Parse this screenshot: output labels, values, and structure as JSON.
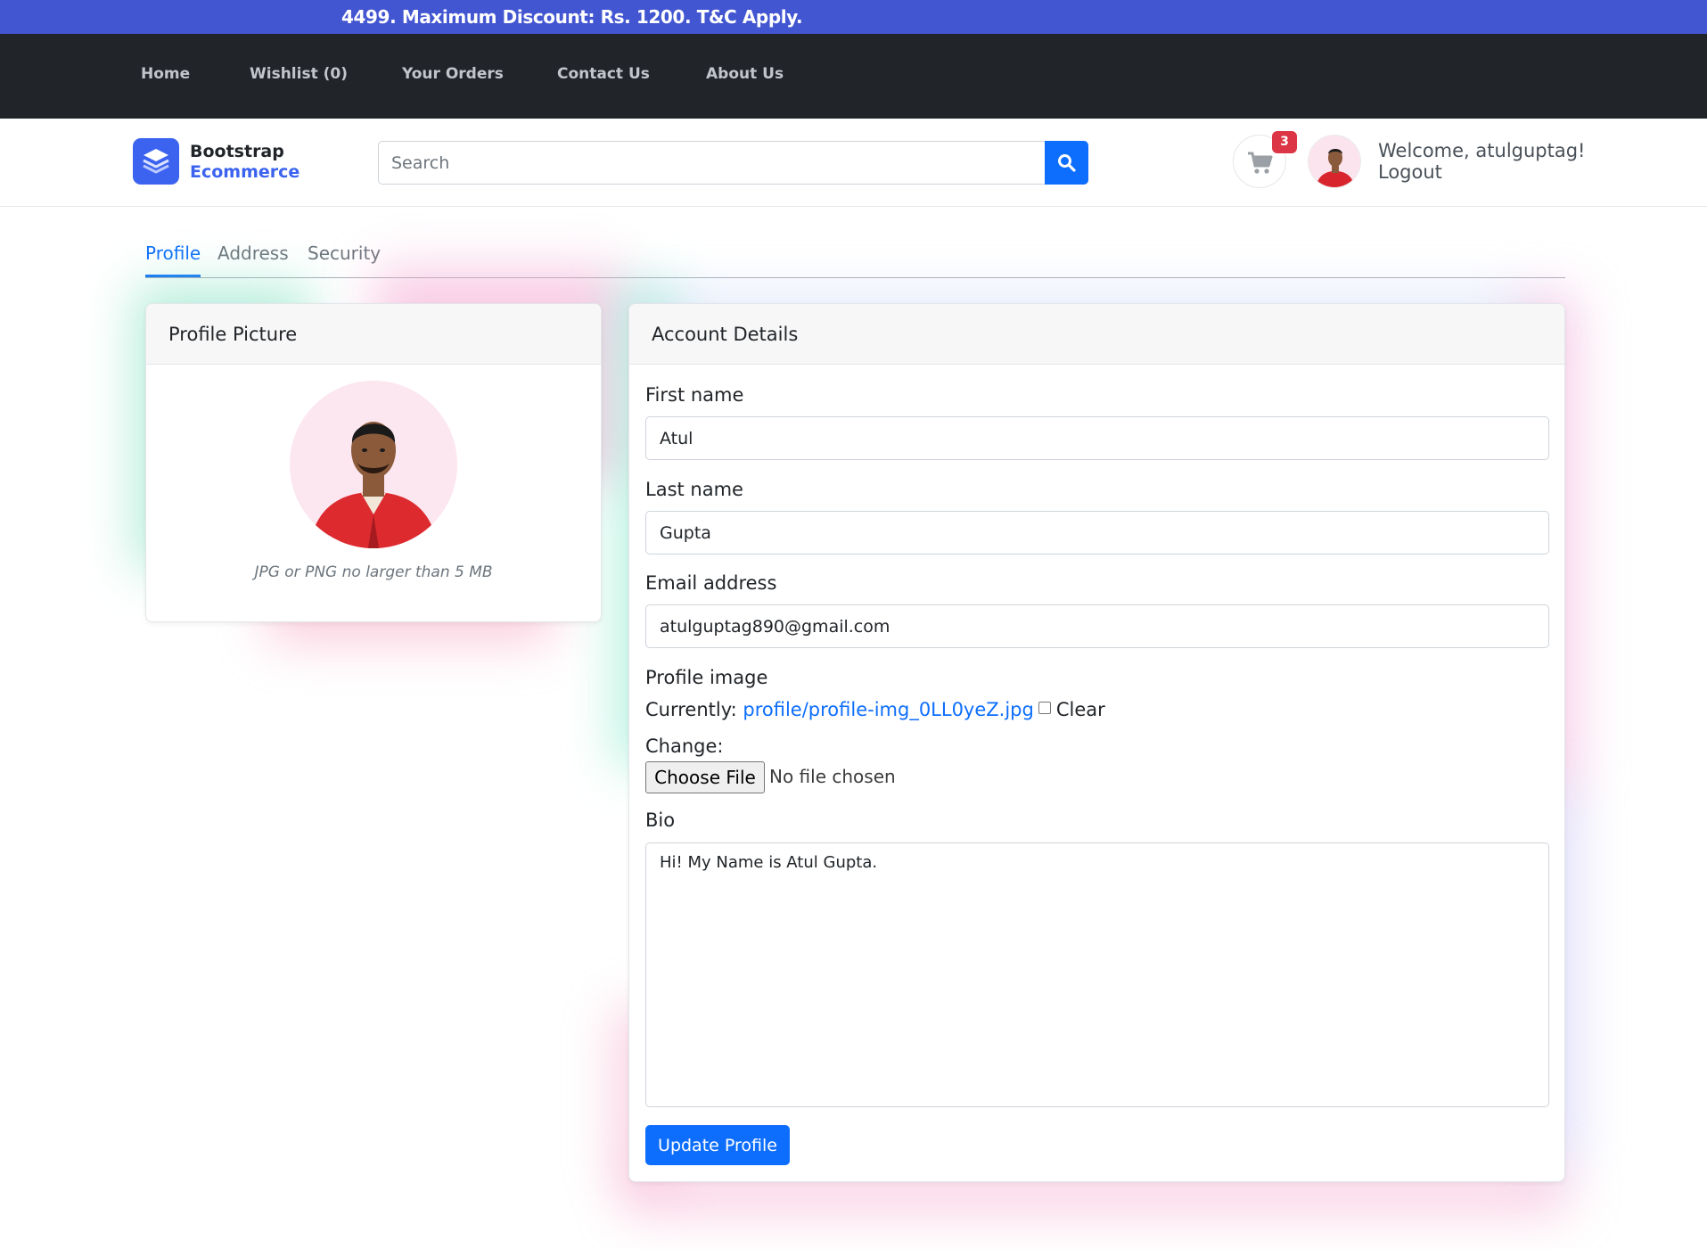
{
  "promo": {
    "text": "4499. Maximum Discount: Rs. 1200. T&C Apply."
  },
  "topnav": {
    "items": [
      {
        "label": "Home"
      },
      {
        "label": "Wishlist (0)"
      },
      {
        "label": "Your Orders"
      },
      {
        "label": "Contact Us"
      },
      {
        "label": "About Us"
      }
    ]
  },
  "header": {
    "brand_line1": "Bootstrap",
    "brand_line2": "Ecommerce",
    "search_placeholder": "Search",
    "cart_count": "3",
    "welcome": "Welcome, atulguptag!",
    "logout": "Logout"
  },
  "tabs": [
    {
      "label": "Profile",
      "active": true
    },
    {
      "label": "Address",
      "active": false
    },
    {
      "label": "Security",
      "active": false
    }
  ],
  "profile_card": {
    "title": "Profile Picture",
    "hint": "JPG or PNG no larger than 5 MB"
  },
  "account_card": {
    "title": "Account Details",
    "first_name_label": "First name",
    "first_name": "Atul",
    "last_name_label": "Last name",
    "last_name": "Gupta",
    "email_label": "Email address",
    "email": "atulguptag890@gmail.com",
    "profile_image_label": "Profile image",
    "currently_label": "Currently:",
    "current_file": "profile/profile-img_0LL0yeZ.jpg",
    "clear_label": "Clear",
    "change_label": "Change:",
    "choose_file_label": "Choose File",
    "no_file_text": "No file chosen",
    "bio_label": "Bio",
    "bio": "Hi! My Name is Atul Gupta.",
    "submit_label": "Update Profile"
  },
  "colors": {
    "promo_bg": "#4356d1",
    "nav_bg": "#212529",
    "accent": "#0d6efd",
    "brand_blue": "#3b63f0",
    "badge": "#dc3545"
  },
  "icons": {
    "logo": "layers-icon",
    "search": "search-icon",
    "cart": "cart-icon"
  }
}
